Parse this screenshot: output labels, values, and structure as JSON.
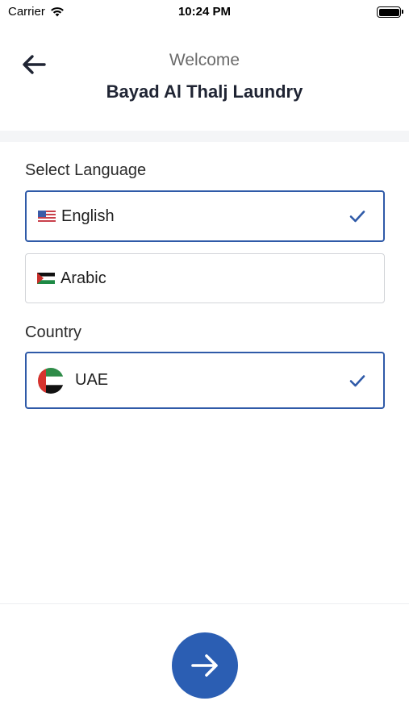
{
  "status_bar": {
    "carrier": "Carrier",
    "time": "10:24 PM"
  },
  "header": {
    "subtitle": "Welcome",
    "title": "Bayad Al Thalj Laundry",
    "back_icon": "arrow-left-icon"
  },
  "language": {
    "label": "Select Language",
    "options": [
      {
        "label": "English",
        "flag": "us-flag-icon",
        "selected": true
      },
      {
        "label": "Arabic",
        "flag": "arabic-flag-icon",
        "selected": false
      }
    ]
  },
  "country": {
    "label": "Country",
    "options": [
      {
        "label": "UAE",
        "flag": "uae-flag-icon",
        "selected": true
      }
    ]
  },
  "footer": {
    "next_icon": "arrow-right-icon"
  },
  "colors": {
    "accent": "#2b5eb3",
    "selected_border": "#2f5aa8",
    "title_text": "#1f2433",
    "subtitle_text": "#6b6b6b"
  }
}
